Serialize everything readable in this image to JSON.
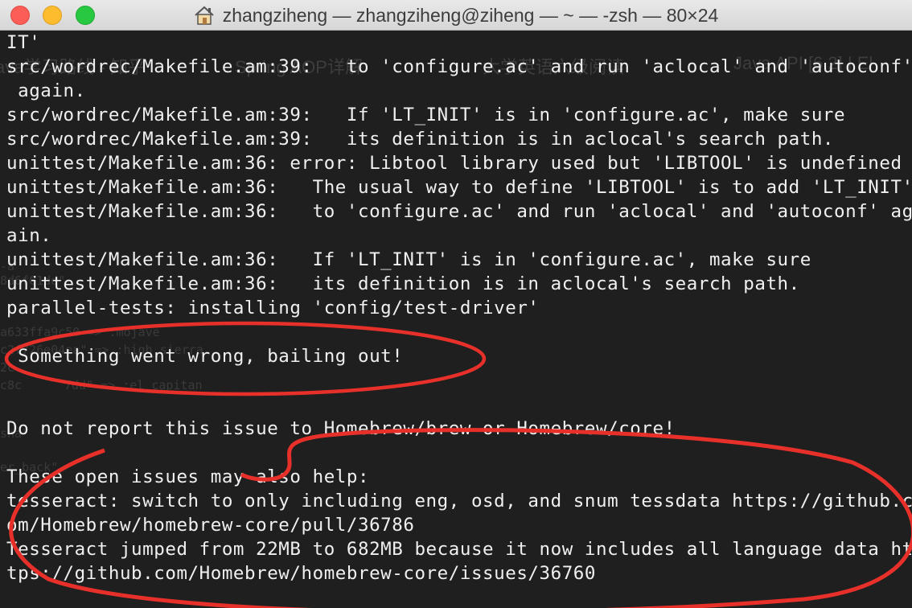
{
  "window": {
    "title": "zhangziheng — zhangziheng@ziheng — ~ — -zsh — 80×24",
    "title_icon": "home-icon"
  },
  "background_ghost": {
    "tabs": [
      "ava学习路线 - 知乎",
      "Spring AOP详解",
      "大学英语六级阅读",
      "Java API [6.2] | El"
    ],
    "code_fragments": [
      "-a",
      "8d6f61dd\"",
      "a633ffa9c50 => :mojave",
      "c2f726e04ea\" => :high_sierra",
      "2c",
      "c8c",
      "7dd\" => :el_capitan",
      "sha\"",
      "er_back\""
    ]
  },
  "terminal": {
    "lines": [
      "IT'",
      "src/wordrec/Makefile.am:39:   to 'configure.ac' and run 'aclocal' and 'autoconf'",
      " again.",
      "src/wordrec/Makefile.am:39:   If 'LT_INIT' is in 'configure.ac', make sure",
      "src/wordrec/Makefile.am:39:   its definition is in aclocal's search path.",
      "unittest/Makefile.am:36: error: Libtool library used but 'LIBTOOL' is undefined",
      "unittest/Makefile.am:36:   The usual way to define 'LIBTOOL' is to add 'LT_INIT'",
      "unittest/Makefile.am:36:   to 'configure.ac' and run 'aclocal' and 'autoconf' ag",
      "ain.",
      "unittest/Makefile.am:36:   If 'LT_INIT' is in 'configure.ac', make sure",
      "unittest/Makefile.am:36:   its definition is in aclocal's search path.",
      "parallel-tests: installing 'config/test-driver'",
      "",
      " Something went wrong, bailing out!",
      "",
      "",
      "Do not report this issue to Homebrew/brew or Homebrew/core!",
      "",
      "These open issues may also help:",
      "tesseract: switch to only including eng, osd, and snum tessdata https://github.c",
      "om/Homebrew/homebrew-core/pull/36786",
      "Tesseract jumped from 22MB to 682MB because it now includes all language data ht",
      "tps://github.com/Homebrew/homebrew-core/issues/36760"
    ]
  },
  "annotations": {
    "color": "#e8302a"
  },
  "colors": {
    "terminal_bg": "#1f1f1f",
    "terminal_text": "#f0f0f0",
    "titlebar": "#dedede"
  }
}
